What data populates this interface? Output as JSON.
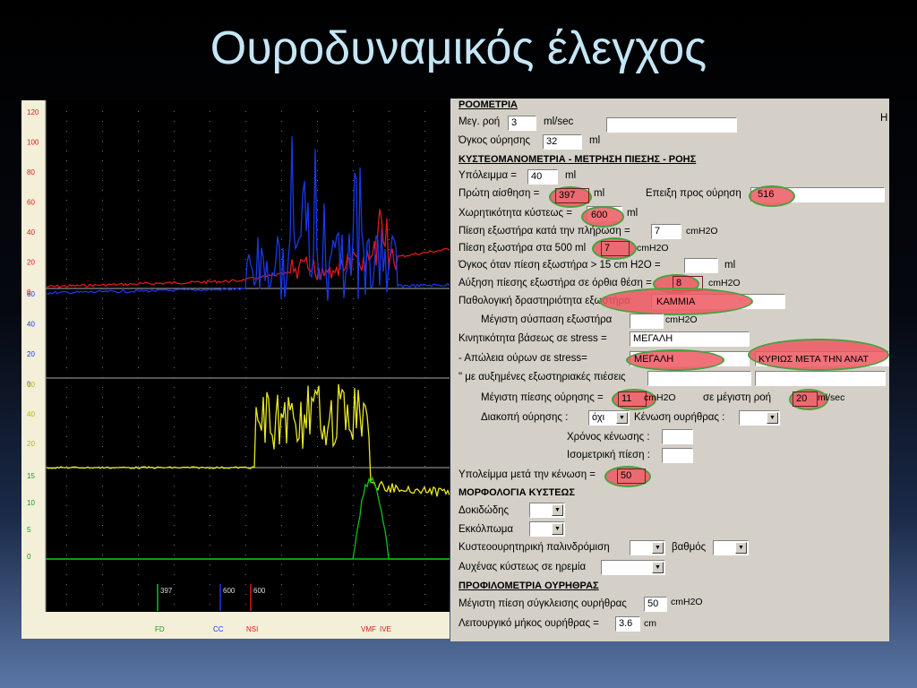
{
  "slide": {
    "title": "Ουροδυναμικός έλεγχος"
  },
  "chart": {
    "scale_top_labels": [
      "120",
      "100",
      "80",
      "60",
      "40",
      "20",
      "0"
    ],
    "scale_mid_labels": [
      "60",
      "40",
      "20",
      "0"
    ],
    "scale_yellow_labels": [
      "60",
      "40",
      "20"
    ],
    "scale_green_labels": [
      "15",
      "10",
      "5",
      "0"
    ],
    "markers": [
      "397",
      "600",
      "600"
    ],
    "bottom_labels": [
      "FD",
      "CC",
      "NSI",
      "VMF",
      "IVE"
    ],
    "colors": {
      "red": "#e01818",
      "blue": "#1838e8",
      "yellow": "#e8e820",
      "green": "#10c020"
    }
  },
  "form": {
    "roometria": {
      "header": "ΡΟΟΜΕΤΡΙΑ",
      "max_flow_label": "Μεγ. ροή",
      "max_flow_value": "3",
      "max_flow_unit": "ml/sec",
      "volume_label": "Όγκος ούρησης",
      "volume_value": "32",
      "volume_unit": "ml",
      "corner_letter": "Η"
    },
    "kysteo": {
      "header": "ΚΥΣΤΕΟΜΑΝΟΜΕΤΡΙΑ - ΜΕΤΡΗΣΗ ΠΙΕΣΗΣ - ΡΟΗΣ",
      "residual_label": "Υπόλειμμα =",
      "residual_value": "40",
      "residual_unit": "ml",
      "first_sensation_label": "Πρώτη αίσθηση =",
      "first_sensation_value": "397",
      "first_sensation_unit": "ml",
      "urgency_label": "Επειξη προς ούρηση",
      "urgency_value": "516",
      "capacity_label": "Χωρητικότητα κύστεως =",
      "capacity_value": "600",
      "capacity_unit": "ml",
      "filling_pressure_label": "Πίεση εξωστήρα κατά την πλήρωση =",
      "filling_pressure_value": "7",
      "filling_pressure_unit": "cmH2O",
      "pressure_500_label": "Πίεση εξωστήρα στα 500 ml",
      "pressure_500_value": "7",
      "pressure_500_unit": "cmH2O",
      "volume_15_label": "Όγκος όταν πίεση εξωστήρα > 15 cm H2O =",
      "volume_15_unit": "ml",
      "upright_increase_label": "Αύξηση πίεσης εξωστήρα σε όρθια θέση =",
      "upright_increase_value": "8",
      "upright_increase_unit": "cmH2O",
      "pathological_label": "Παθολογική δραστηριότητα εξωστήρα",
      "pathological_value": "ΚΑΜΜΙΑ",
      "max_contraction_label": "Μέγιστη σύσπαση εξωστήρα",
      "max_contraction_unit": "cmH2O",
      "base_mobility_label": "Κινητικότητα βάσεως σε stress =",
      "base_mobility_value": "ΜΕΓΑΛΗ",
      "urine_loss_label": "- Απώλεια ούρων σε stress=",
      "urine_loss_value": "ΜΕΓΑΛΗ",
      "urine_loss_extra": "ΚΥΡΙΩΣ ΜΕΤΑ ΤΗΝ ΑΝΑΤ",
      "increased_pressure_label": "\" με αυξημένες εξωστηριακές πιέσεις",
      "max_voiding_pressure_label": "Μέγιστη πίεσης ούρησης =",
      "max_voiding_pressure_value": "11",
      "max_voiding_pressure_unit": "cmH2O",
      "at_max_flow_label": "σε μέγιστη ροή",
      "at_max_flow_value": "20",
      "at_max_flow_unit": "ml/sec",
      "interruption_label": "Διακοπή ούρησης :",
      "interruption_value": "όχι",
      "urethra_emptying_label": "Κένωση ουρήθρας :",
      "emptying_time_label": "Χρόνος κένωσης :",
      "isometric_label": "Ισομετρική πίεση :",
      "post_void_residual_label": "Υπολείμμα μετά την κένωση =",
      "post_void_residual_value": "50"
    },
    "morfologia": {
      "header": "ΜΟΡΦΟΛΟΓΙΑ ΚΥΣΤΕΩΣ",
      "trabeculation_label": "Δοκιδώδης",
      "diverticulum_label": "Εκκόλπωμα",
      "reflux_label": "Κυστεοουρητηρική παλινδρόμιση",
      "grade_label": "βαθμός",
      "neck_label": "Αυχένας κύστεως σε ηρεμία"
    },
    "profilometria": {
      "header": "ΠΡΟΦΙΛΟΜΕΤΡΙΑ ΟΥΡΗΘΡΑΣ",
      "max_closure_label": "Μέγιστη πίεση σύγκλεισης ουρήθρας",
      "max_closure_value": "50",
      "max_closure_unit": "cmH2O",
      "functional_length_label": "Λειτουργικό μήκος ουρήθρας =",
      "functional_length_value": "3.6",
      "functional_length_unit": "cm"
    }
  }
}
